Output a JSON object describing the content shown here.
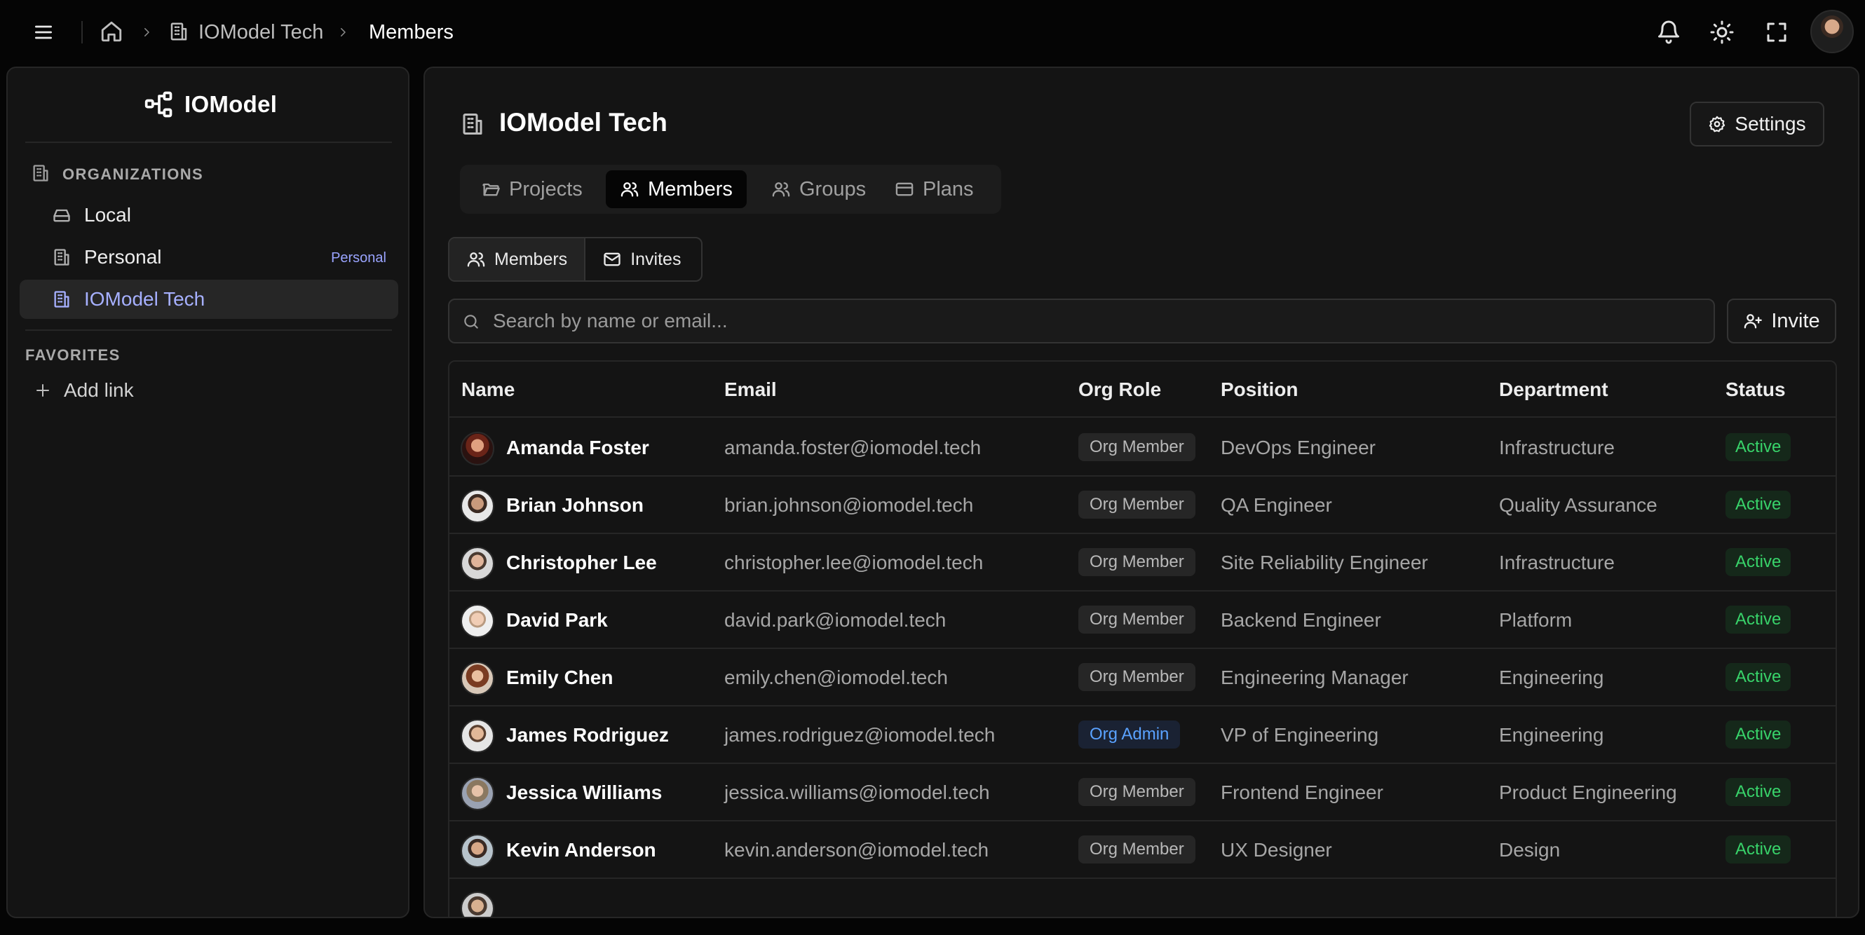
{
  "header": {
    "breadcrumbs": [
      "IOModel Tech",
      "Members"
    ]
  },
  "sidebar": {
    "logo_text": "IOModel",
    "organizations_heading": "ORGANIZATIONS",
    "orgs": [
      {
        "label": "Local",
        "badge": "",
        "icon": "inbox-icon"
      },
      {
        "label": "Personal",
        "badge": "Personal",
        "icon": "building-icon"
      },
      {
        "label": "IOModel Tech",
        "badge": "",
        "icon": "building-icon",
        "active": true
      }
    ],
    "favorites_heading": "FAVORITES",
    "add_link_label": "Add link"
  },
  "main": {
    "title": "IOModel Tech",
    "settings_label": "Settings",
    "tabs": [
      {
        "label": "Projects",
        "icon": "folder-icon"
      },
      {
        "label": "Members",
        "icon": "users-icon",
        "active": true
      },
      {
        "label": "Groups",
        "icon": "users-icon"
      },
      {
        "label": "Plans",
        "icon": "credit-card-icon"
      }
    ],
    "segments": [
      {
        "label": "Members",
        "icon": "users-icon",
        "active": true
      },
      {
        "label": "Invites",
        "icon": "mail-icon"
      }
    ],
    "search": {
      "placeholder": "Search by name or email...",
      "value": ""
    },
    "invite_label": "Invite"
  },
  "table": {
    "columns": [
      "Name",
      "Email",
      "Org Role",
      "Position",
      "Department",
      "Status"
    ],
    "rows": [
      {
        "name": "Amanda Foster",
        "email": "amanda.foster@iomodel.tech",
        "role": "Org Member",
        "position": "DevOps Engineer",
        "department": "Infrastructure",
        "status": "Active"
      },
      {
        "name": "Brian Johnson",
        "email": "brian.johnson@iomodel.tech",
        "role": "Org Member",
        "position": "QA Engineer",
        "department": "Quality Assurance",
        "status": "Active"
      },
      {
        "name": "Christopher Lee",
        "email": "christopher.lee@iomodel.tech",
        "role": "Org Member",
        "position": "Site Reliability Engineer",
        "department": "Infrastructure",
        "status": "Active"
      },
      {
        "name": "David Park",
        "email": "david.park@iomodel.tech",
        "role": "Org Member",
        "position": "Backend Engineer",
        "department": "Platform",
        "status": "Active"
      },
      {
        "name": "Emily Chen",
        "email": "emily.chen@iomodel.tech",
        "role": "Org Member",
        "position": "Engineering Manager",
        "department": "Engineering",
        "status": "Active"
      },
      {
        "name": "James Rodriguez",
        "email": "james.rodriguez@iomodel.tech",
        "role": "Org Admin",
        "position": "VP of Engineering",
        "department": "Engineering",
        "status": "Active"
      },
      {
        "name": "Jessica Williams",
        "email": "jessica.williams@iomodel.tech",
        "role": "Org Member",
        "position": "Frontend Engineer",
        "department": "Product Engineering",
        "status": "Active"
      },
      {
        "name": "Kevin Anderson",
        "email": "kevin.anderson@iomodel.tech",
        "role": "Org Member",
        "position": "UX Designer",
        "department": "Design",
        "status": "Active"
      },
      {
        "name": "",
        "email": "",
        "role": "",
        "position": "",
        "department": "",
        "status": ""
      }
    ]
  },
  "colors": {
    "accent": "#a6b0ff",
    "status_active": "#38d36a",
    "role_admin": "#5aa2ff"
  }
}
